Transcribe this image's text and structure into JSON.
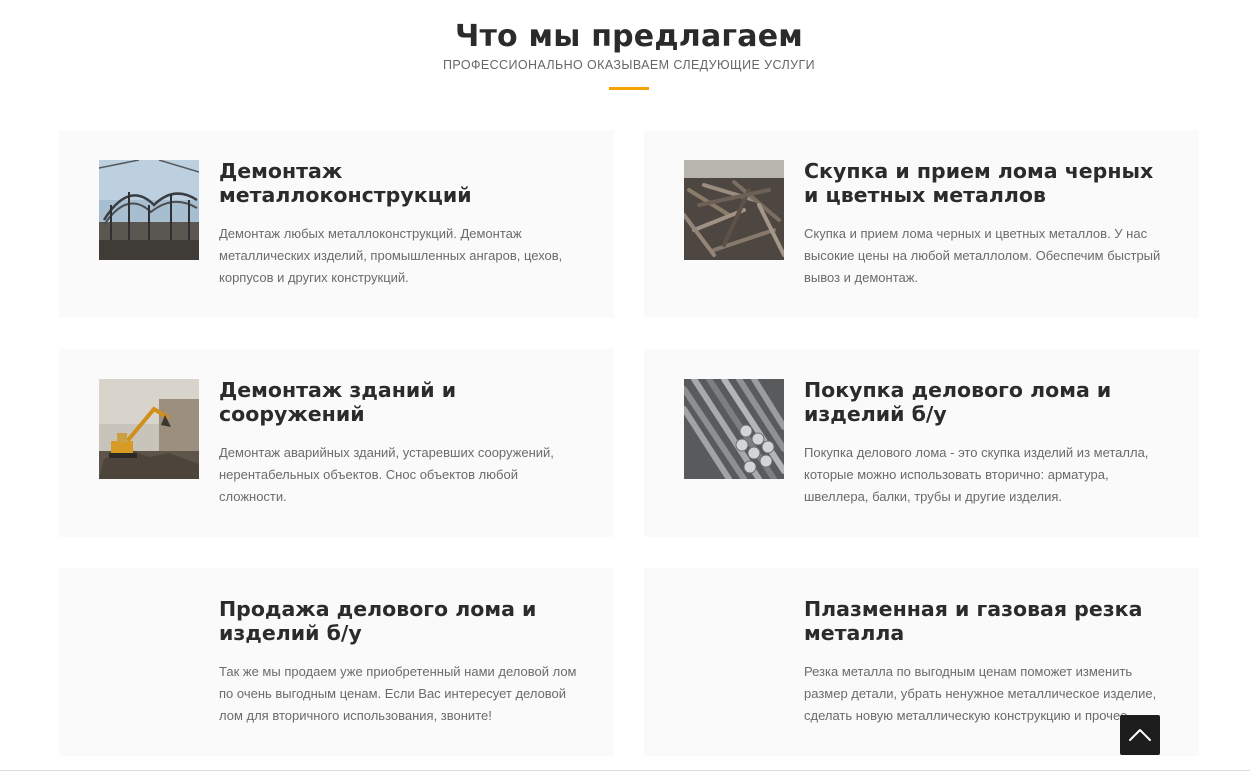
{
  "section": {
    "title": "Что мы предлагаем",
    "subtitle": "ПРОФЕССИОНАЛЬНО ОКАЗЫВАЕМ СЛЕДУЮЩИЕ УСЛУГИ",
    "accent_color": "#f5a300"
  },
  "services": [
    {
      "title": "Демонтаж металлоконструкций",
      "description": "Демонтаж любых металлоконструкций. Демонтаж металлических изделий, промышленных ангаров, цехов, корпусов и других конструкций.",
      "image": "steel-frame-dismantling-photo"
    },
    {
      "title": "Скупка и прием лома черных и цветных металлов",
      "description": "Скупка и прием лома черных и цветных металлов. У нас высокие цены на любой металлолом. Обеспечим быстрый вывоз и демонтаж.",
      "image": "scrap-metal-pile-photo"
    },
    {
      "title": "Демонтаж зданий и сооружений",
      "description": "Демонтаж аварийных зданий, устаревших сооружений, нерентабельных объектов. Снос объектов любой сложности.",
      "image": "excavator-demolition-photo"
    },
    {
      "title": "Покупка делового лома и изделий б/у",
      "description": "Покупка делового лома - это скупка изделий из металла, которые можно использовать вторично: арматура, швеллера, балки, трубы и другие изделия.",
      "image": "steel-rods-bundle-photo"
    },
    {
      "title": "Продажа делового лома и изделий б/у",
      "description": "Так же мы продаем уже приобретенный нами деловой лом по очень выгодным ценам. Если Вас интересует деловой лом для вторичного использования, звоните!",
      "image": null
    },
    {
      "title": "Плазменная и газовая резка металла",
      "description": "Резка металла по выгодным ценам поможет изменить размер детали, убрать ненужное металлическое изделие, сделать новую металлическую конструкцию и прочее.",
      "image": null
    }
  ],
  "scroll_top": {
    "icon": "chevron-up-icon"
  }
}
